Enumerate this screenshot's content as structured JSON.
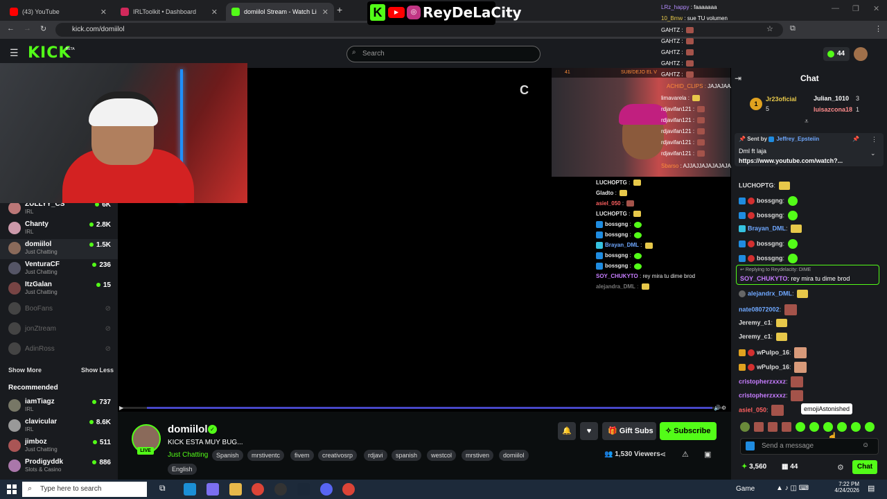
{
  "browser": {
    "tabs": [
      {
        "title": "(43) YouTube",
        "color": "#ff0000"
      },
      {
        "title": "IRLToolkit • Dashboard",
        "color": "#d1295b"
      },
      {
        "title": "domiilol Stream - Watch Li",
        "color": "#53fc18"
      }
    ],
    "url": "kick.com/domiilol"
  },
  "overlay_brand": {
    "name": "ReyDeLaCity"
  },
  "header": {
    "logo": "KICK",
    "beta": "BETA",
    "search_placeholder": "Search",
    "notifications": "44"
  },
  "sidebar": {
    "following": [
      {
        "name": "ZULLYY_CS",
        "category": "IRL",
        "viewers": "6K",
        "online": true
      },
      {
        "name": "Chanty",
        "category": "IRL",
        "viewers": "2.8K",
        "online": true
      },
      {
        "name": "domiilol",
        "category": "Just Chatting",
        "viewers": "1.5K",
        "online": true,
        "selected": true
      },
      {
        "name": "VenturaCF",
        "category": "Just Chatting",
        "viewers": "236",
        "online": true
      },
      {
        "name": "ItzGalan",
        "category": "Just Chatting",
        "viewers": "15",
        "online": true
      },
      {
        "name": "BooFans",
        "online": false
      },
      {
        "name": "jonZtream",
        "online": false
      },
      {
        "name": "AdinRoss",
        "online": false
      }
    ],
    "show_more": "Show More",
    "show_less": "Show Less",
    "recommended_title": "Recommended",
    "recommended": [
      {
        "name": "iamTiagz",
        "category": "IRL",
        "viewers": "737"
      },
      {
        "name": "clavicular",
        "category": "IRL",
        "viewers": "8.6K"
      },
      {
        "name": "jimboz",
        "category": "Just Chatting",
        "viewers": "511"
      },
      {
        "name": "Prodigyddk",
        "category": "Slots & Casino",
        "viewers": "886"
      }
    ]
  },
  "video": {
    "pip_label": "SUB/DEJO EL V",
    "pip_num": "41",
    "cut_logo": "C"
  },
  "overlay_chat_top": [
    {
      "user": "LRz_happy",
      "text": "faaaaaaa",
      "color": "#b48cff"
    },
    {
      "user": "10_Bmw",
      "text": "sue TU volumen",
      "color": "#e7c84a"
    },
    {
      "user": "GAHTZ",
      "text": "",
      "color": "#ffffff"
    },
    {
      "user": "GAHTZ",
      "text": "",
      "color": "#ffffff"
    },
    {
      "user": "GAHTZ",
      "text": "",
      "color": "#ffffff"
    },
    {
      "user": "GAHTZ",
      "text": "",
      "color": "#ffffff"
    },
    {
      "user": "GAHTZ",
      "text": "",
      "color": "#ffffff"
    }
  ],
  "overlay_chat_pip": [
    {
      "user": "ACHID_CLIPS",
      "text": "JAJAJAAAJ"
    },
    {
      "user": "limavarela",
      "text": ""
    },
    {
      "user": "rdjavifan121",
      "text": ""
    },
    {
      "user": "rdjavifan121",
      "text": ""
    },
    {
      "user": "rdjavifan121",
      "text": ""
    },
    {
      "user": "rdjavifan121",
      "text": ""
    },
    {
      "user": "rdjavifan121",
      "text": ""
    },
    {
      "user": "Sbarso",
      "text": "AJJAJJAJAJAJAJA A YOUUUUUUUUUUUU"
    }
  ],
  "overlay_chat_video": [
    {
      "user": "LUCHOPTG",
      "text": "",
      "color": "#ffffff"
    },
    {
      "user": "Gladto",
      "text": "",
      "color": "#ffffff"
    },
    {
      "user": "asiel_050",
      "text": "",
      "color": "#ff6060"
    },
    {
      "user": "LUCHOPTG",
      "text": "",
      "color": "#ffffff"
    },
    {
      "user": "bossgng",
      "text": "",
      "color": "#ffffff"
    },
    {
      "user": "bossgng",
      "text": "",
      "color": "#ffffff"
    },
    {
      "user": "Brayan_DML",
      "text": "",
      "color": "#6fa8ff"
    },
    {
      "user": "bossgng",
      "text": "",
      "color": "#ffffff"
    },
    {
      "user": "bossgng",
      "text": "",
      "color": "#ffffff"
    },
    {
      "user": "SOY_CHUKYTO",
      "text": "rey mira tu dime brod",
      "color": "#c77dff"
    },
    {
      "user": "alejandra_DML",
      "text": "",
      "color": "#777777"
    }
  ],
  "stream": {
    "streamer": "domiilol",
    "live": "LIVE",
    "title": "KICK ESTA  MUY BUG...",
    "category": "Just Chatting",
    "tags": [
      "Spanish",
      "mrstiventc",
      "fivem",
      "creativosrp",
      "rdjavi",
      "spanish",
      "westcol",
      "mrstiven",
      "domiilol",
      "English"
    ],
    "gift_subs": "Gift Subs",
    "subscribe": "Subscribe",
    "viewers": "1,530 Viewers",
    "accent": "#53fc18"
  },
  "chat": {
    "title": "Chat",
    "leaderboard": [
      {
        "rank": "1",
        "user": "Jr23oficial",
        "count": "5"
      },
      {
        "user": "Julian_1010",
        "count": "3"
      },
      {
        "user": "luisazcona18",
        "count": "1"
      }
    ],
    "pinned": {
      "sent_by_label": "Sent by",
      "user": "Jeffrey_Epsteiin",
      "text": "Dml ft laja",
      "link": "https://www.youtube.com/watch?..."
    },
    "messages": [
      {
        "user": "LUCHOPTG",
        "text": "",
        "color": "#ffffff"
      },
      {
        "user": "bossgng",
        "text": "",
        "color": "#ffffff"
      },
      {
        "user": "bossgng",
        "text": "",
        "color": "#ffffff"
      },
      {
        "user": "Brayan_DML",
        "text": "",
        "color": "#6fa8ff"
      },
      {
        "user": "bossgng",
        "text": "",
        "color": "#ffffff"
      },
      {
        "user": "bossgng",
        "text": "",
        "color": "#ffffff"
      }
    ],
    "reply": {
      "label": "Replying to Reydelacity: DIME",
      "user": "SOY_CHUKYTO",
      "text": "rey mira tu dime brod"
    },
    "messages2": [
      {
        "user": "alejandrx_DML",
        "color": "#6fa8ff"
      },
      {
        "user": "nate08072002",
        "color": "#6fa8ff"
      },
      {
        "user": "Jeremy_c1",
        "color": "#ffffff"
      },
      {
        "user": "Jeremy_c1",
        "color": "#ffffff"
      },
      {
        "user": "wPulpo_16",
        "color": "#ffffff"
      },
      {
        "user": "wPulpo_16",
        "color": "#ffffff"
      },
      {
        "user": "cristopherzxxxz",
        "color": "#c77dff"
      },
      {
        "user": "cristopherzxxxz",
        "color": "#c77dff"
      },
      {
        "user": "asiel_050",
        "color": "#ff6060"
      }
    ],
    "tooltip": "emojiAstonished",
    "input_placeholder": "Send a message",
    "points": "3,560",
    "bag": "44",
    "chat_button": "Chat"
  },
  "taskbar": {
    "search": "Type here to search",
    "game": "Game",
    "time": "7:22 PM",
    "date": "4/24/2026"
  }
}
